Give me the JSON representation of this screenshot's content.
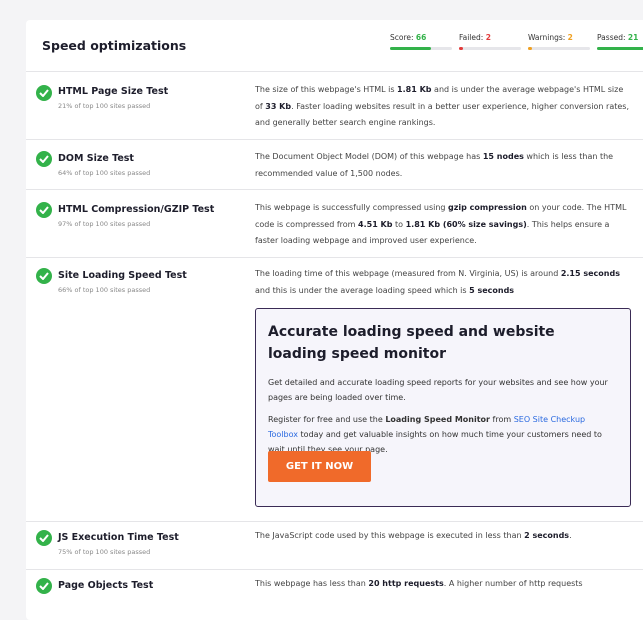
{
  "section": {
    "title": "Speed optimizations"
  },
  "stats": [
    {
      "label": "Score: ",
      "value": "66",
      "color": "#33b24a",
      "fraction": 0.66
    },
    {
      "label": "Failed: ",
      "value": "2",
      "color": "#e23b3b",
      "fraction": 0.05
    },
    {
      "label": "Warnings: ",
      "value": "2",
      "color": "#f0a020",
      "fraction": 0.05
    },
    {
      "label": "Passed: ",
      "value": "21",
      "color": "#33b24a",
      "fraction": 1.0
    }
  ],
  "tests": [
    {
      "name": "HTML Page Size Test",
      "sub": "21% of top 100 sites passed",
      "desc": [
        "The size of this webpage's HTML is ",
        "1.81 Kb",
        " and is under the average webpage's HTML size of ",
        "33 Kb",
        ". Faster loading websites result in a better user experience, higher conversion rates, and generally better search engine rankings."
      ]
    },
    {
      "name": "DOM Size Test",
      "sub": "64% of top 100 sites passed",
      "desc": [
        "The Document Object Model (DOM) of this webpage has ",
        "15 nodes",
        " which is less than the recommended value of 1,500 nodes."
      ]
    },
    {
      "name": "HTML Compression/GZIP Test",
      "sub": "97% of top 100 sites passed",
      "desc": [
        "This webpage is successfully compressed using ",
        "gzip compression",
        " on your code. The HTML code is compressed from ",
        "4.51 Kb",
        " to ",
        "1.81 Kb (60% size savings)",
        ". This helps ensure a faster loading webpage and improved user experience."
      ]
    },
    {
      "name": "Site Loading Speed Test",
      "sub": "66% of top 100 sites passed",
      "desc": [
        "The loading time of this webpage (measured from N. Virginia, US) is around ",
        "2.15 seconds",
        " and this is under the average loading speed which is ",
        "5 seconds"
      ]
    },
    {
      "name": "JS Execution Time Test",
      "sub": "75% of top 100 sites passed",
      "desc": [
        "The JavaScript code used by this webpage is executed in less than ",
        "2 seconds",
        "."
      ]
    },
    {
      "name": "Page Objects Test",
      "sub": "",
      "desc": [
        "This webpage has less than ",
        "20 http requests",
        ". A higher number of http requests"
      ]
    }
  ],
  "promo": {
    "title": "Accurate loading speed and website loading speed monitor",
    "p1": "Get detailed and accurate loading speed reports for your websites and see how your pages are being loaded over time.",
    "p2_a": "Register for free and use the ",
    "p2_b": "Loading Speed Monitor",
    "p2_c": " from ",
    "p2_link": "SEO Site Checkup Toolbox",
    "p2_d": " today and get valuable insights on how much time your customers need to wait until they see your page.",
    "cta": "GET IT NOW"
  }
}
